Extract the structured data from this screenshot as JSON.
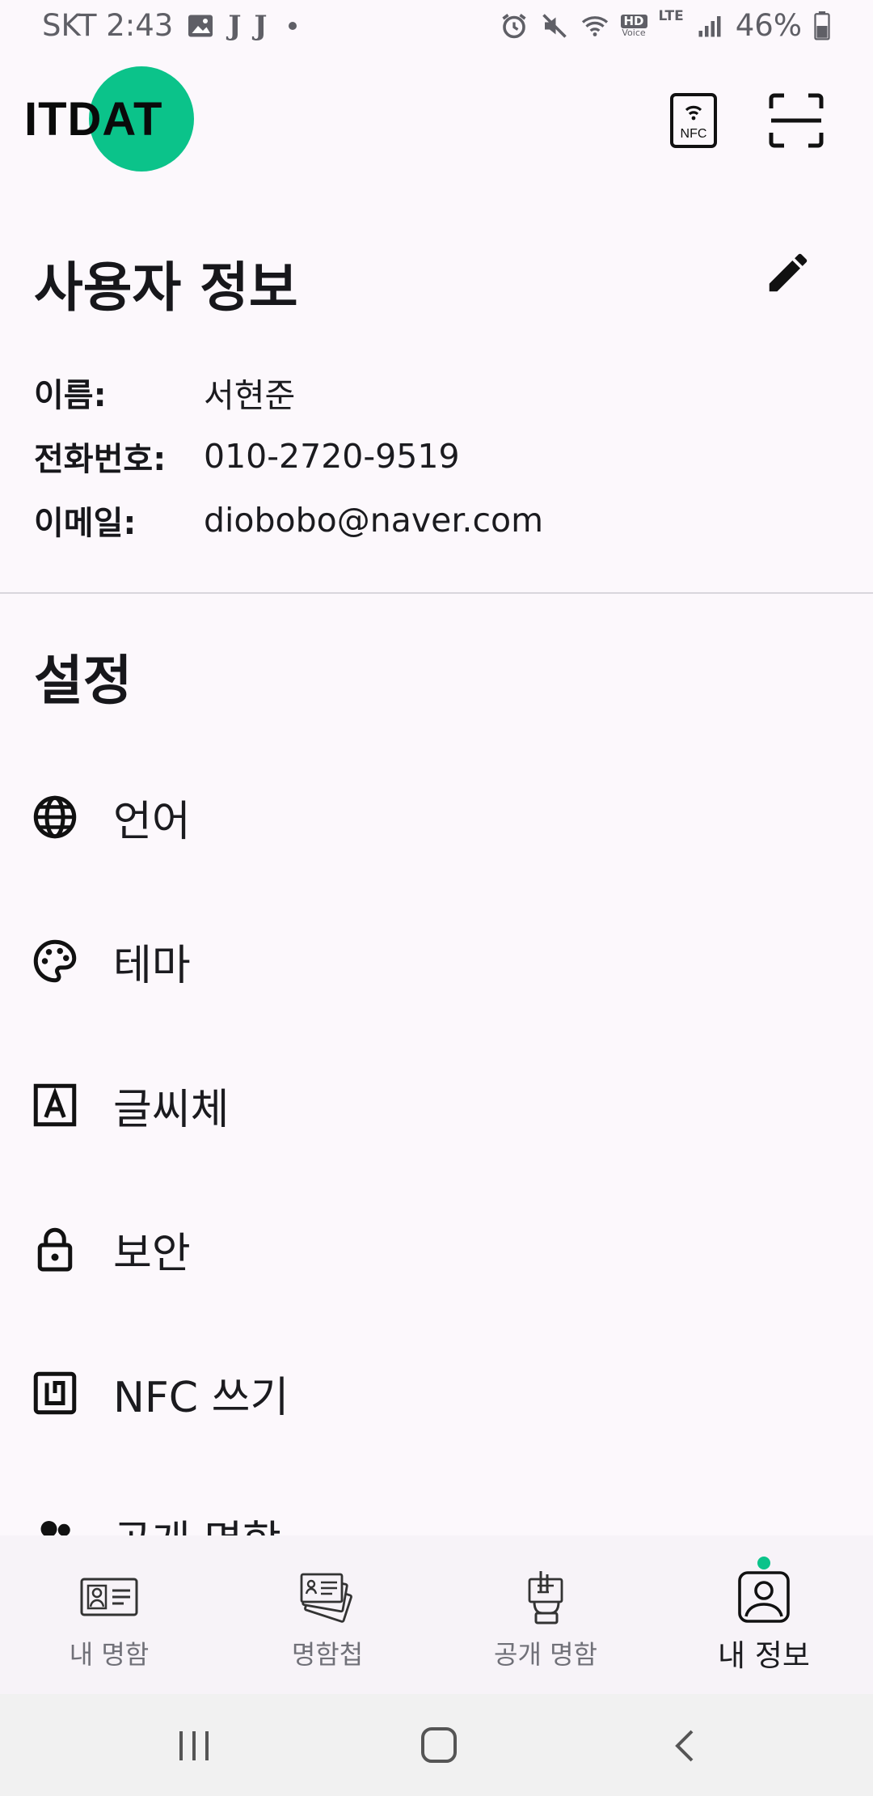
{
  "status_bar": {
    "carrier_time": "SKT 2:43",
    "glyph_1": "J",
    "glyph_2": "J",
    "network_hd": "HD",
    "network_voice": "Voice",
    "network_lte": "LTE",
    "battery": "46%"
  },
  "app_bar": {
    "logo_text": "ITDAT",
    "nfc_icon_text": "NFC"
  },
  "user_info": {
    "title": "사용자 정보",
    "fields": [
      {
        "label": "이름:",
        "value": "서현준"
      },
      {
        "label": "전화번호:",
        "value": "010-2720-9519"
      },
      {
        "label": "이메일:",
        "value": "diobobo@naver.com"
      }
    ]
  },
  "settings": {
    "title": "설정",
    "items": [
      {
        "label": "언어",
        "icon": "globe-icon"
      },
      {
        "label": "테마",
        "icon": "palette-icon"
      },
      {
        "label": "글씨체",
        "icon": "font-icon"
      },
      {
        "label": "보안",
        "icon": "lock-icon"
      },
      {
        "label": "NFC 쓰기",
        "icon": "nfc-icon"
      },
      {
        "label": "공개 명함",
        "icon": "people-icon"
      }
    ]
  },
  "bottom_nav": {
    "items": [
      {
        "label": "내 명함",
        "icon": "id-card-icon"
      },
      {
        "label": "명함첩",
        "icon": "card-stack-icon"
      },
      {
        "label": "공개 명함",
        "icon": "hand-card-icon"
      },
      {
        "label": "내 정보",
        "icon": "profile-icon"
      }
    ],
    "active_index": 3
  },
  "colors": {
    "accent": "#0bc38a",
    "background": "#fcf8fc",
    "nav_background": "#f7f3f8",
    "system_nav": "#f1f1f1"
  }
}
